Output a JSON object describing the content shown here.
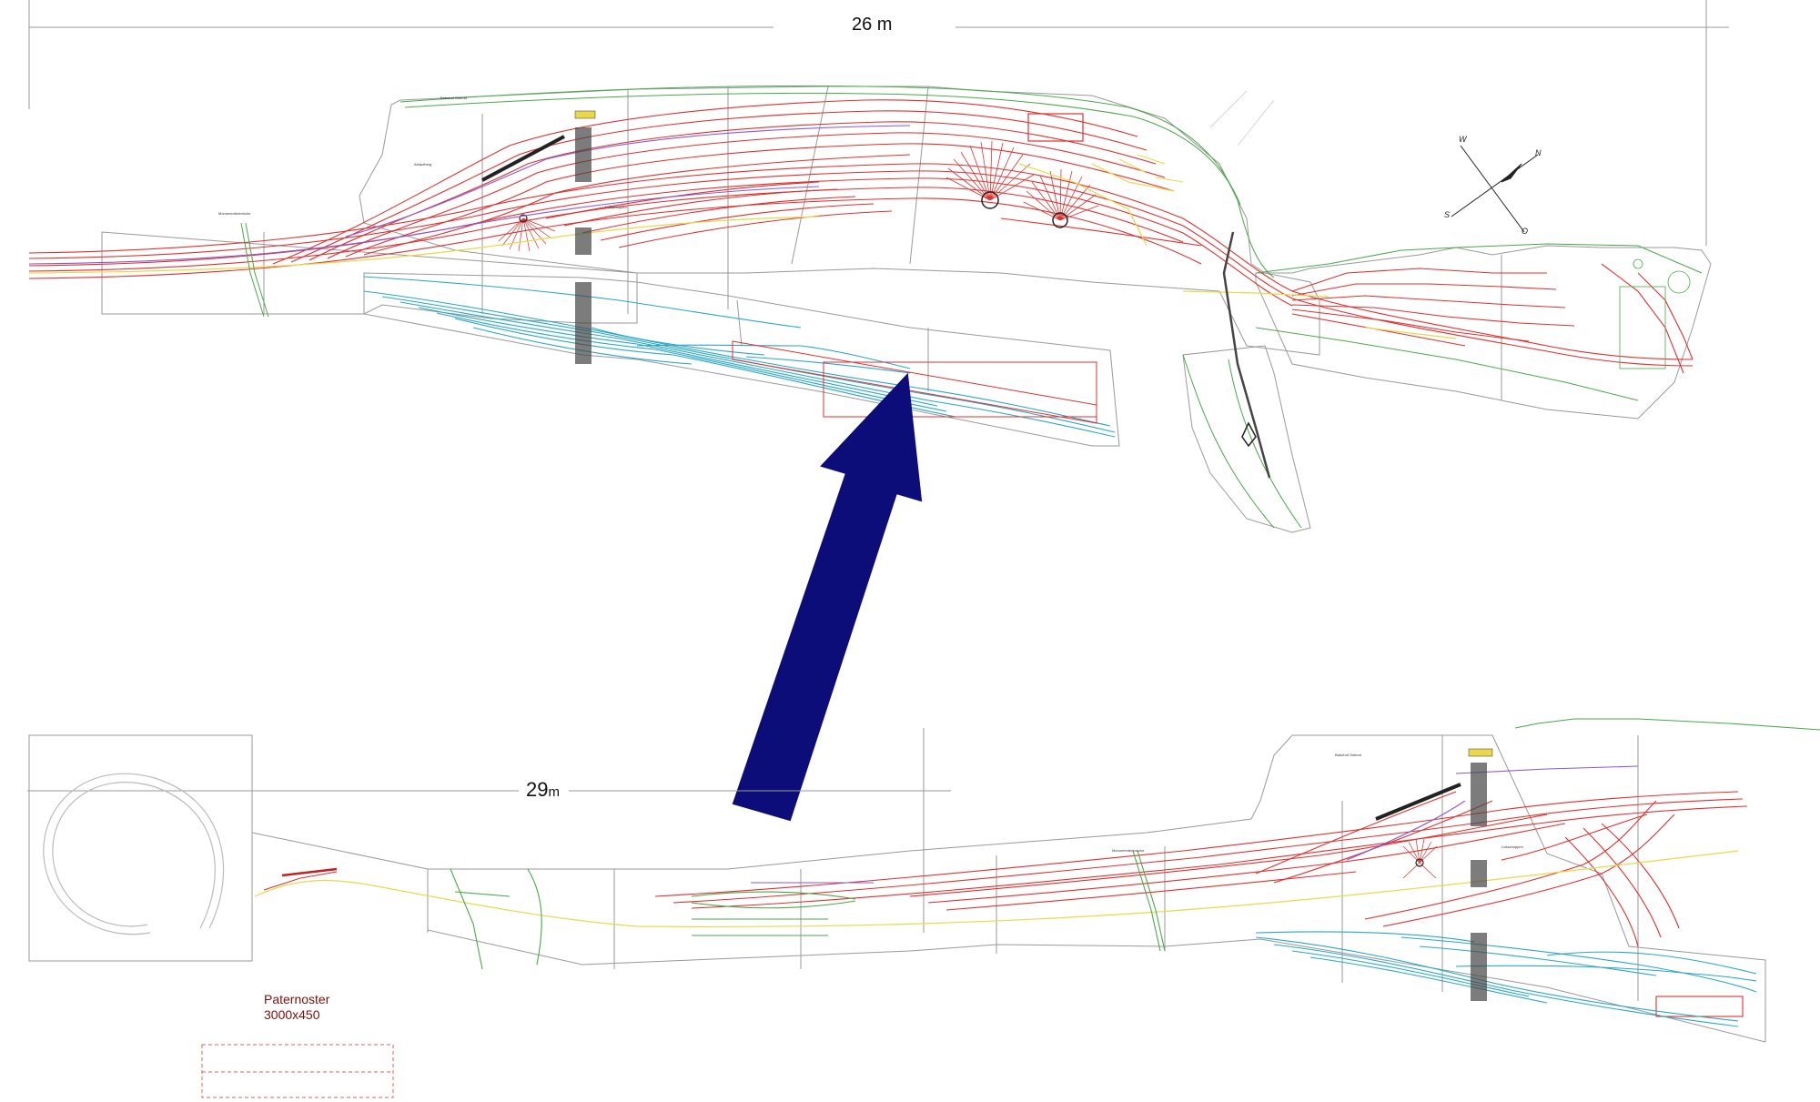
{
  "top_plan": {
    "length_label": "26 m",
    "compass": {
      "w": "W",
      "n": "N",
      "s": "S",
      "o": "O"
    },
    "labels": {
      "bridge": "Monumentenbrücke",
      "station_a": "Bahnhof Ostend",
      "depot": "Lokschuppen",
      "yard": "Ablaufberg"
    }
  },
  "bottom_plan": {
    "length_label": "29",
    "length_unit": "m",
    "labels": {
      "bridge": "Monumentenbrücke",
      "station_a": "Bahnhof Ostend",
      "depot": "Lokschuppen"
    }
  },
  "paternoster": {
    "title": "Paternoster",
    "size": "3000x450"
  },
  "colors": {
    "track_main": "#e03030",
    "track_yard": "#2aa6c6",
    "track_yellow": "#e8d84a",
    "track_green": "#4aa84a",
    "track_purple": "#8a5ad0",
    "outline": "#888888",
    "arrow": "#0d0d7a"
  }
}
